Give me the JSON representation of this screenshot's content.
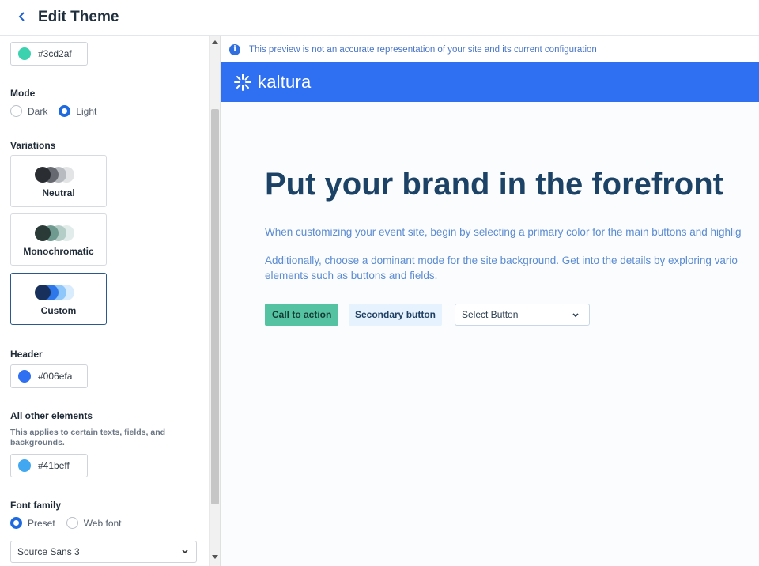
{
  "header": {
    "title": "Edit Theme"
  },
  "left": {
    "primary_color": {
      "value": "#3cd2af",
      "color": "#3cd2af"
    },
    "mode": {
      "label": "Mode",
      "options": [
        "Dark",
        "Light"
      ],
      "selected": "Light"
    },
    "variations": {
      "label": "Variations",
      "items": [
        {
          "name": "Neutral",
          "colors": [
            "#2a2d31",
            "#666a70",
            "#b8bcc1",
            "#e2e4e6"
          ]
        },
        {
          "name": "Monochromatic",
          "colors": [
            "#2a3a36",
            "#6f9a8f",
            "#b5cdc7",
            "#e2ecea"
          ]
        },
        {
          "name": "Custom",
          "colors": [
            "#17315c",
            "#2e77ea",
            "#8fc7fb",
            "#d9ecfe"
          ]
        }
      ],
      "selected": "Custom"
    },
    "header_color": {
      "label": "Header",
      "value": "#006efa",
      "color": "#2f6ff1"
    },
    "other_elements": {
      "label": "All other elements",
      "hint": "This applies to certain texts, fields, and backgrounds.",
      "value": "#41beff",
      "color": "#41a7f0"
    },
    "font_family": {
      "label": "Font family",
      "options": [
        "Preset",
        "Web font"
      ],
      "selected": "Preset",
      "value": "Source Sans 3"
    }
  },
  "preview": {
    "notice": "This preview is not an accurate representation of your site and its current configuration",
    "brand_name": "kaltura",
    "hero_title": "Put your brand in the forefront",
    "paragraph1": "When customizing your event site, begin by selecting a primary color for the main buttons and highlig",
    "paragraph2": "Additionally, choose a dominant mode for the site background. Get into the details by exploring vario elements such as buttons and fields.",
    "cta_label": "Call to action",
    "secondary_label": "Secondary button",
    "select_label": "Select Button"
  }
}
